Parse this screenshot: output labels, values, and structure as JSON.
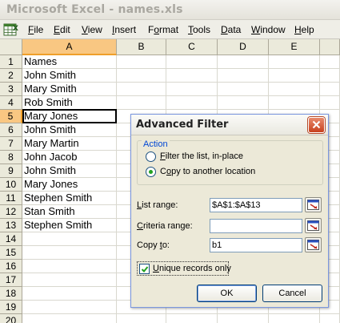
{
  "window": {
    "title": "Microsoft Excel - names.xls"
  },
  "menubar": {
    "icon": "excel-sheet-icon",
    "items": [
      {
        "underline": "F",
        "rest": "ile"
      },
      {
        "underline": "E",
        "rest": "dit"
      },
      {
        "underline": "V",
        "rest": "iew"
      },
      {
        "underline": "I",
        "rest": "nsert"
      },
      {
        "pre": "F",
        "underline": "o",
        "rest": "rmat"
      },
      {
        "underline": "T",
        "rest": "ools"
      },
      {
        "underline": "D",
        "rest": "ata"
      },
      {
        "underline": "W",
        "rest": "indow"
      },
      {
        "underline": "H",
        "rest": "elp"
      }
    ]
  },
  "sheet": {
    "columns": [
      "A",
      "B",
      "C",
      "D",
      "E"
    ],
    "selected_column": "A",
    "rows": [
      "1",
      "2",
      "3",
      "4",
      "5",
      "6",
      "7",
      "8",
      "9",
      "10",
      "11",
      "12",
      "13",
      "14",
      "15",
      "16",
      "17",
      "18",
      "19",
      "20"
    ],
    "selected_row": "5",
    "active_cell": "A5",
    "col_a_values": [
      "Names",
      "John Smith",
      "Mary Smith",
      "Rob Smith",
      "Mary Jones",
      "John Smith",
      "Mary Martin",
      "John Jacob",
      "John Smith",
      "Mary Jones",
      "Stephen Smith",
      "Stan Smith",
      "Stephen Smith"
    ]
  },
  "dialog": {
    "title": "Advanced Filter",
    "action_label": "Action",
    "radio_filter": {
      "underline": "F",
      "rest": "ilter the list, in-place",
      "selected": false
    },
    "radio_copy": {
      "pre": "C",
      "underline": "o",
      "rest": "py to another location",
      "selected": true
    },
    "list_range": {
      "underline": "L",
      "rest": "ist range:",
      "value": "$A$1:$A$13"
    },
    "criteria_range": {
      "underline": "C",
      "rest": "riteria range:",
      "value": ""
    },
    "copy_to": {
      "label_pre": "Copy ",
      "underline": "t",
      "rest": "o:",
      "value": "b1"
    },
    "unique": {
      "pre": "",
      "underline": "U",
      "rest": "nique records only",
      "checked": true
    },
    "ok_label": "OK",
    "cancel_label": "Cancel",
    "accent": "#0046d5",
    "close_color": "#c7401d"
  }
}
